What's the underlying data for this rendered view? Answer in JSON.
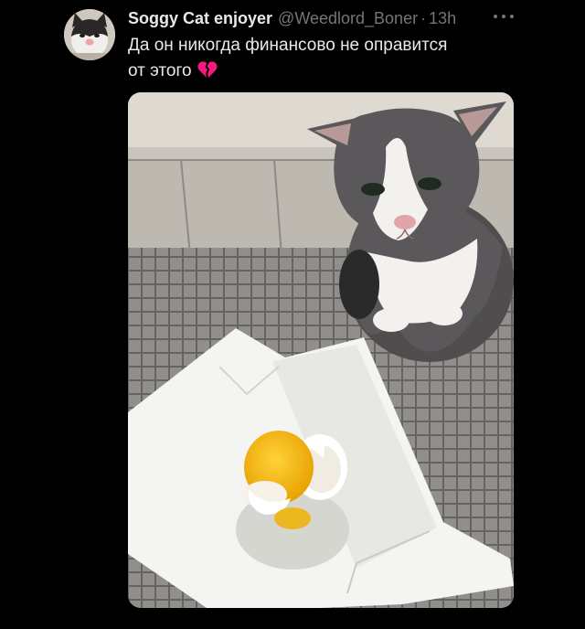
{
  "tweet": {
    "display_name": "Soggy Cat enjoyer",
    "handle": "@Weedlord_Boner",
    "separator": "·",
    "time": "13h",
    "text_line1": "Да он никогда финансово не оправится",
    "text_line2": "от этого",
    "emoji": "broken-heart-icon"
  },
  "colors": {
    "background": "#000000",
    "primary_text": "#e7e9ea",
    "secondary_text": "#71767b",
    "heart": "#f91880"
  }
}
